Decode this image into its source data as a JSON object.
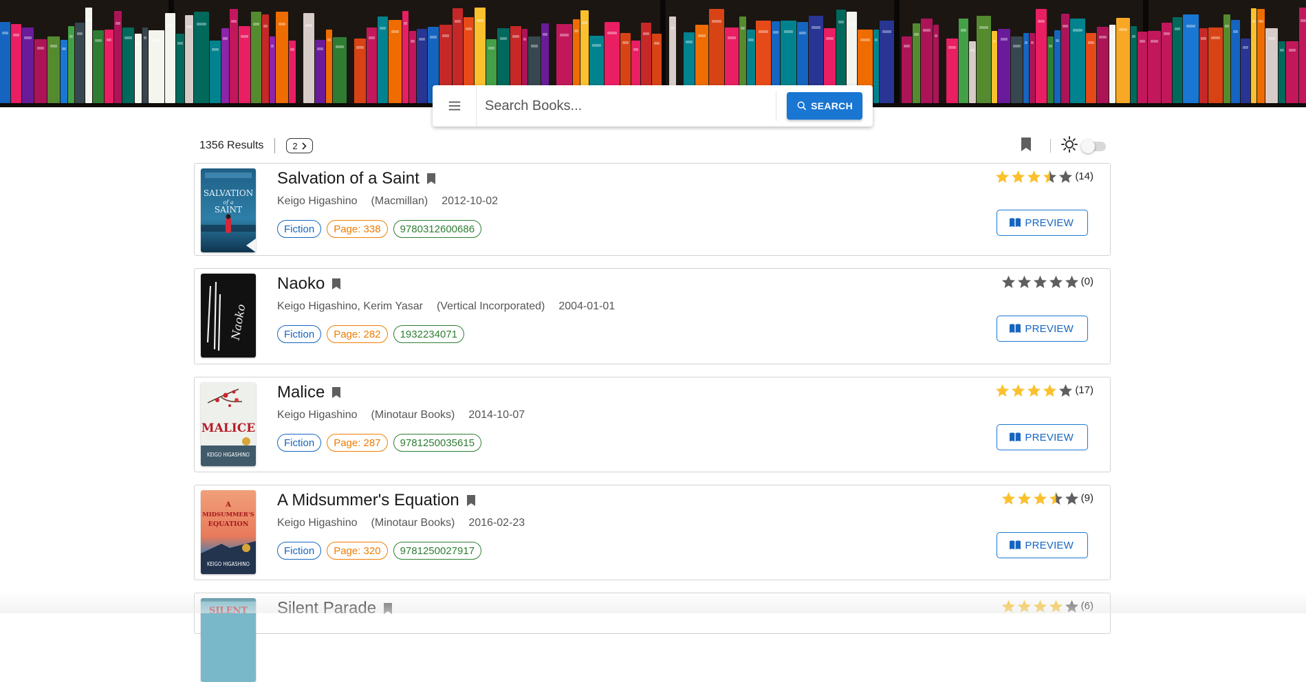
{
  "search": {
    "placeholder": "Search Books...",
    "button_label": "SEARCH",
    "menu_icon": "menu-icon",
    "search_icon": "search-icon"
  },
  "toolbar": {
    "results": "1356 Results",
    "page": "2",
    "bookmark_icon": "bookmark-icon",
    "theme_icon": "sun-icon",
    "dark_mode": false
  },
  "colors": {
    "primary": "#1976d2",
    "star": "#fbc02d",
    "star_empty": "#5f5f5f",
    "genre": "#1565c0",
    "pages": "#ef7c00",
    "isbn": "#2e7d32"
  },
  "books": [
    {
      "title": "Salvation of a Saint",
      "authors": "Keigo Higashino",
      "publisher": "(Macmillan)",
      "date": "2012-10-02",
      "genre": "Fiction",
      "pages": "Page: 338",
      "isbn": "9780312600686",
      "rating": 3.5,
      "rating_count": "(14)",
      "preview_label": "PREVIEW",
      "cover": {
        "text1": "SALVATION",
        "text2": "of a",
        "text3": "SAINT",
        "author": "KEIGO HIGASHINO"
      }
    },
    {
      "title": "Naoko",
      "authors": "Keigo Higashino, Kerim Yasar",
      "publisher": "(Vertical Incorporated)",
      "date": "2004-01-01",
      "genre": "Fiction",
      "pages": "Page: 282",
      "isbn": "1932234071",
      "rating": 0,
      "rating_count": "(0)",
      "preview_label": "PREVIEW",
      "cover": {
        "text1": "Naoko"
      }
    },
    {
      "title": "Malice",
      "authors": "Keigo Higashino",
      "publisher": "(Minotaur Books)",
      "date": "2014-10-07",
      "genre": "Fiction",
      "pages": "Page: 287",
      "isbn": "9781250035615",
      "rating": 4,
      "rating_count": "(17)",
      "preview_label": "PREVIEW",
      "cover": {
        "text1": "MALICE",
        "author": "KEIGO HIGASHINO"
      }
    },
    {
      "title": "A Midsummer's Equation",
      "authors": "Keigo Higashino",
      "publisher": "(Minotaur Books)",
      "date": "2016-02-23",
      "genre": "Fiction",
      "pages": "Page: 320",
      "isbn": "9781250027917",
      "rating": 3.5,
      "rating_count": "(9)",
      "preview_label": "PREVIEW",
      "cover": {
        "text1": "A",
        "text2": "MIDSUMMER'S",
        "text3": "EQUATION",
        "author": "KEIGO HIGASHINO"
      }
    },
    {
      "title": "Silent Parade",
      "rating": 4,
      "rating_count": "(6)",
      "cover": {
        "text1": "SILENT"
      }
    }
  ]
}
